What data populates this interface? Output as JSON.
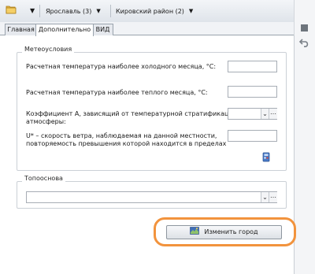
{
  "toolbar": {
    "folder_icon": "folder-icon",
    "region_label": "Ярославль (3)",
    "district_label": "Кировский район (2)"
  },
  "tabs": [
    {
      "label": "Главная",
      "active": false
    },
    {
      "label": "Дополнительно",
      "active": true
    },
    {
      "label": "ВИД",
      "active": false
    }
  ],
  "rail": {
    "icons": [
      "square-icon",
      "undo-icon"
    ]
  },
  "weather": {
    "title": "Метеоусловия",
    "fields": [
      {
        "label": "Расчетная температура наиболее холодного месяца, °C:",
        "value": ""
      },
      {
        "label": "Расчетная температура наиболее теплого месяца, °C:",
        "value": ""
      },
      {
        "label_line1": "Коэффициент А, зависящий от температурной стратификации",
        "label_line2": "атмосферы:",
        "value": ""
      },
      {
        "label_line1": "U* – скорость ветра, наблюдаемая на данной местности,",
        "label_line2": "повторяемость превышения которой находится в пределах",
        "value": ""
      }
    ],
    "calc_icon": "calculator-icon"
  },
  "topo": {
    "title": "Топооснова",
    "value": ""
  },
  "change_city_button": {
    "label": "Изменить город",
    "icon": "city-map-icon"
  },
  "colors": {
    "highlight": "#f2933d",
    "accent": "#1b5fb5"
  }
}
